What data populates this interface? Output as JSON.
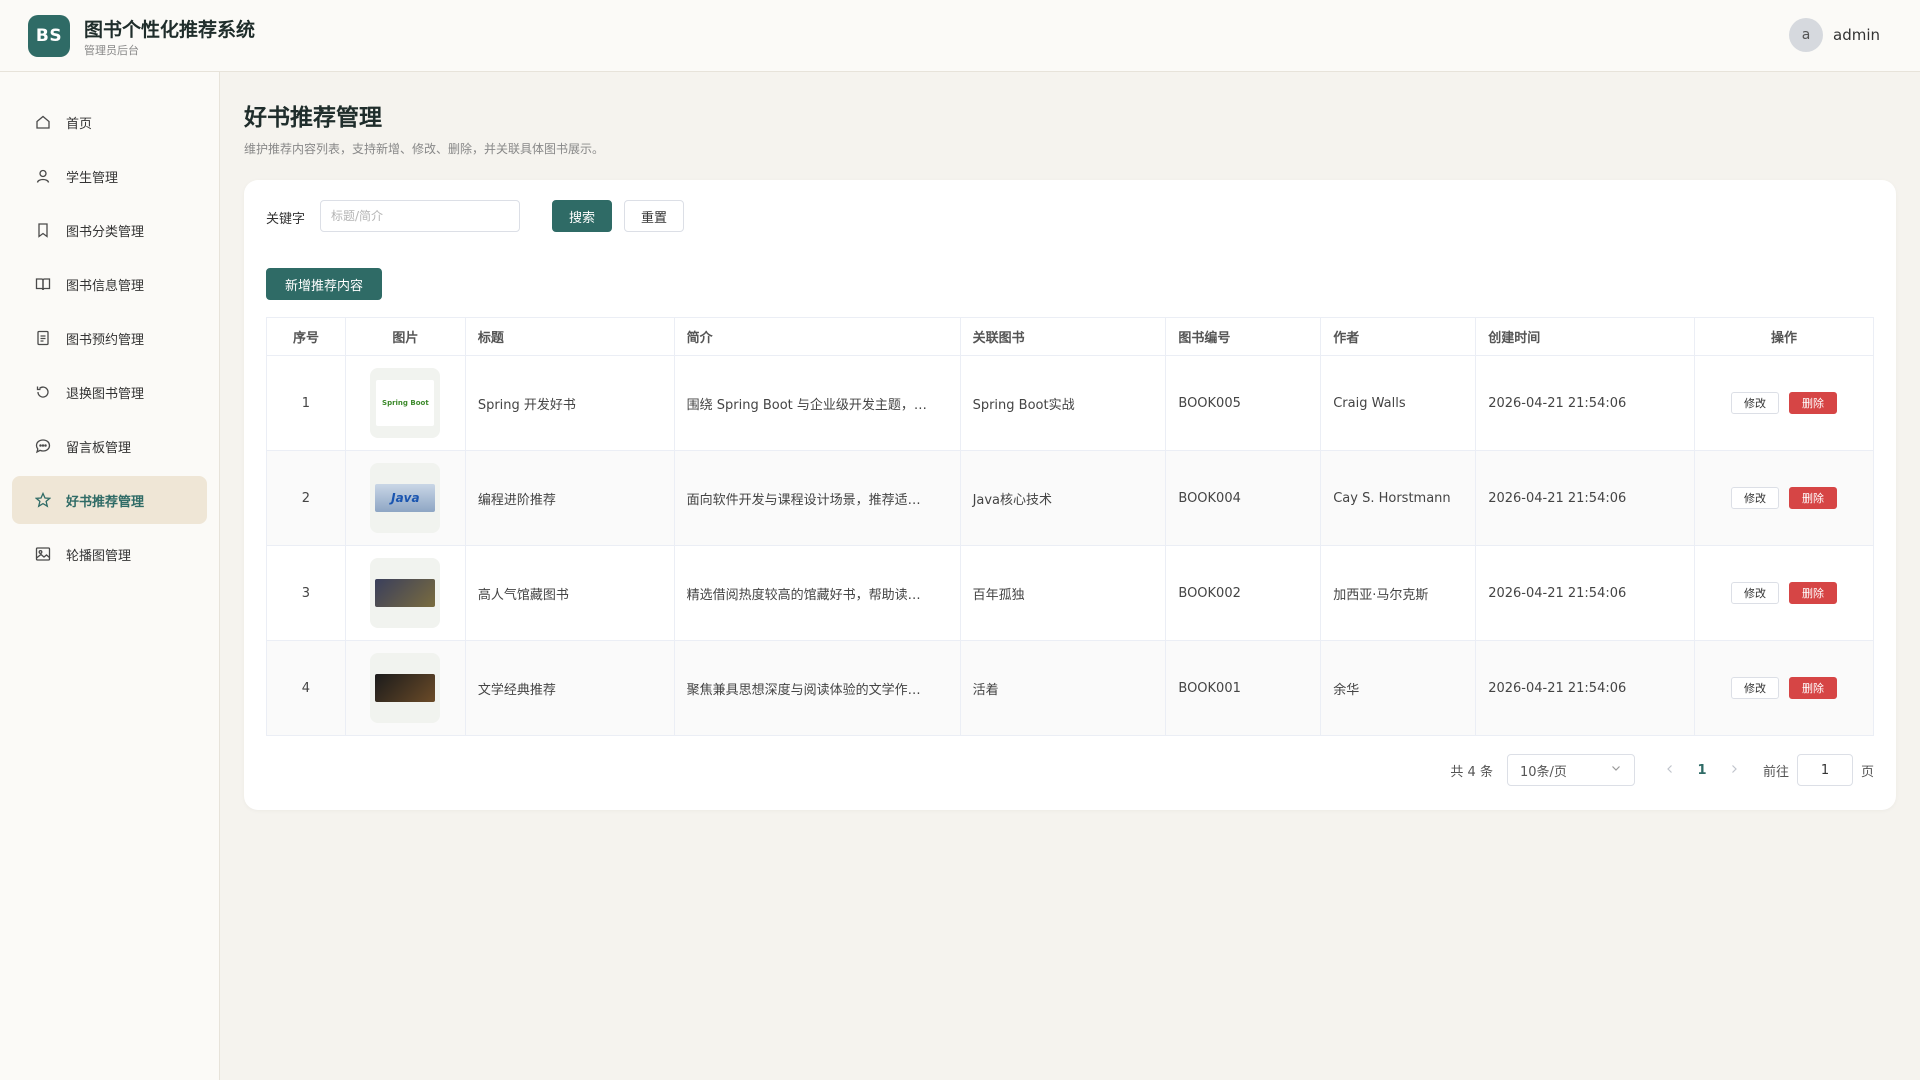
{
  "app": {
    "logo_text": "BS",
    "title": "图书个性化推荐系统",
    "subtitle": "管理员后台",
    "user": {
      "avatar_letter": "a",
      "name": "admin"
    }
  },
  "sidebar": {
    "items": [
      {
        "label": "首页",
        "icon": "home-icon",
        "active": false
      },
      {
        "label": "学生管理",
        "icon": "user-icon",
        "active": false
      },
      {
        "label": "图书分类管理",
        "icon": "bookmark-icon",
        "active": false
      },
      {
        "label": "图书信息管理",
        "icon": "book-open-icon",
        "active": false
      },
      {
        "label": "图书预约管理",
        "icon": "document-icon",
        "active": false
      },
      {
        "label": "退换图书管理",
        "icon": "refresh-icon",
        "active": false
      },
      {
        "label": "留言板管理",
        "icon": "chat-icon",
        "active": false
      },
      {
        "label": "好书推荐管理",
        "icon": "star-icon",
        "active": true
      },
      {
        "label": "轮播图管理",
        "icon": "image-icon",
        "active": false
      }
    ]
  },
  "page": {
    "title": "好书推荐管理",
    "description": "维护推荐内容列表，支持新增、修改、删除，并关联具体图书展示。"
  },
  "filter": {
    "keyword_label": "关键字",
    "keyword_placeholder": "标题/简介",
    "keyword_value": "",
    "search_label": "搜索",
    "reset_label": "重置",
    "add_label": "新增推荐内容"
  },
  "table": {
    "headers": [
      "序号",
      "图片",
      "标题",
      "简介",
      "关联图书",
      "图书编号",
      "作者",
      "创建时间",
      "操作"
    ],
    "edit_label": "修改",
    "delete_label": "删除",
    "rows": [
      {
        "index": "1",
        "image_text": "Spring Boot",
        "title": "Spring 开发好书",
        "intro": "围绕 Spring Boot 与企业级开发主题，…",
        "book": "Spring Boot实战",
        "book_no": "BOOK005",
        "author": "Craig Walls",
        "created": "2026-04-21 21:54:06"
      },
      {
        "index": "2",
        "image_text": "Java",
        "title": "编程进阶推荐",
        "intro": "面向软件开发与课程设计场景，推荐适…",
        "book": "Java核心技术",
        "book_no": "BOOK004",
        "author": "Cay S. Horstmann",
        "created": "2026-04-21 21:54:06"
      },
      {
        "index": "3",
        "image_text": "",
        "title": "高人气馆藏图书",
        "intro": "精选借阅热度较高的馆藏好书，帮助读…",
        "book": "百年孤独",
        "book_no": "BOOK002",
        "author": "加西亚·马尔克斯",
        "created": "2026-04-21 21:54:06"
      },
      {
        "index": "4",
        "image_text": "",
        "title": "文学经典推荐",
        "intro": "聚焦兼具思想深度与阅读体验的文学作…",
        "book": "活着",
        "book_no": "BOOK001",
        "author": "余华",
        "created": "2026-04-21 21:54:06"
      }
    ]
  },
  "pagination": {
    "total_text": "共 4 条",
    "page_size": "10条/页",
    "current_page": "1",
    "goto_label": "前往",
    "goto_value": "1",
    "unit_label": "页"
  },
  "colors": {
    "primary": "#2f6b66",
    "danger": "#d64545",
    "active_nav_bg": "#efe6d6",
    "page_bg": "#f5f3ee"
  }
}
